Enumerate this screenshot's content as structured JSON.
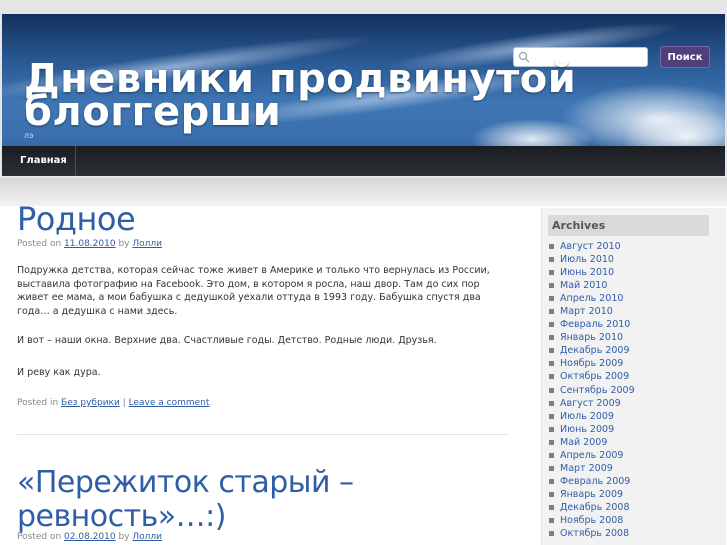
{
  "header": {
    "site_title": "Дневники продвинутой блоггерши",
    "tagline": "лэ",
    "search": {
      "placeholder": "",
      "value": "",
      "button_label": "Поиск"
    },
    "nav": [
      {
        "label": "Главная"
      }
    ]
  },
  "posts": [
    {
      "title": "Родное",
      "meta": {
        "prefix": "Posted on",
        "date": "11.08.2010",
        "by": "by",
        "author": "Лолли"
      },
      "paragraphs": [
        "Подружка детства, которая сейчас тоже живет в Америке и только что вернулась из России, выставила фотографию на Facebook. Это дом, в котором я росла, наш двор. Там до сих пор живет ее мама, а мои бабушка с дедушкой уехали оттуда в 1993 году. Бабушка спустя два года… а дедушка с нами здесь.",
        "И вот – наши окна. Верхние два. Счастливые годы. Детство. Родные люди. Друзья.",
        "И реву как дура."
      ],
      "footer": {
        "prefix": "Posted in",
        "category": "Без рубрики",
        "separator": "|",
        "comment_link": "Leave a comment"
      }
    },
    {
      "title_line1": "«Пережиток старый –",
      "title_line2": "ревность»…:)",
      "meta": {
        "prefix": "Posted on",
        "date": "02.08.2010",
        "by": "by",
        "author": "Лолли"
      }
    }
  ],
  "sidebar": {
    "archives_title": "Archives",
    "archives": [
      "Август 2010",
      "Июль 2010",
      "Июнь 2010",
      "Май 2010",
      "Апрель 2010",
      "Март 2010",
      "Февраль 2010",
      "Январь 2010",
      "Декабрь 2009",
      "Ноябрь 2009",
      "Октябрь 2009",
      "Сентябрь 2009",
      "Август 2009",
      "Июль 2009",
      "Июнь 2009",
      "Май 2009",
      "Апрель 2009",
      "Март 2009",
      "Февраль 2009",
      "Январь 2009",
      "Декабрь 2008",
      "Ноябрь 2008",
      "Октябрь 2008"
    ]
  },
  "colors": {
    "link": "#2f5ea6",
    "search_button": "#4f3f7a",
    "navbar": "#24272c"
  }
}
